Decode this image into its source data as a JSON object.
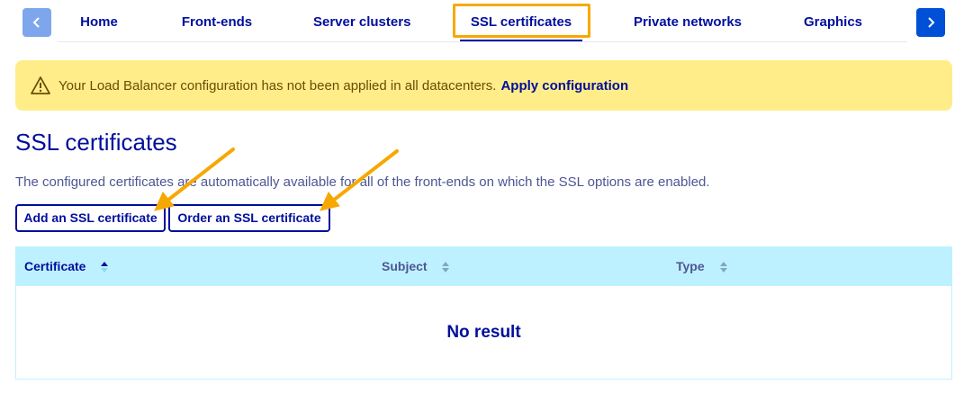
{
  "tabs": {
    "items": [
      {
        "label": "Home"
      },
      {
        "label": "Front-ends"
      },
      {
        "label": "Server clusters"
      },
      {
        "label": "SSL certificates"
      },
      {
        "label": "Private networks"
      },
      {
        "label": "Graphics"
      }
    ],
    "active": "SSL certificates",
    "prev_icon": "chevron-left-icon",
    "next_icon": "chevron-right-icon"
  },
  "banner": {
    "message": "Your Load Balancer configuration has not been applied in all datacenters.",
    "link_label": "Apply configuration",
    "icon": "warning-icon"
  },
  "page": {
    "title": "SSL certificates",
    "description": "The configured certificates are automatically available for all of the front-ends on which the SSL options are enabled."
  },
  "actions": {
    "add_label": "Add an SSL certificate",
    "order_label": "Order an SSL certificate"
  },
  "table": {
    "columns": [
      {
        "label": "Certificate",
        "sort": "active"
      },
      {
        "label": "Subject",
        "sort": "none"
      },
      {
        "label": "Type",
        "sort": "none"
      }
    ],
    "empty_text": "No result"
  },
  "colors": {
    "primary": "#000e9c",
    "accent_button": "#0050d7",
    "warning_bg": "#ffed89",
    "table_header_bg": "#bef1ff",
    "highlight": "#f7a800"
  }
}
